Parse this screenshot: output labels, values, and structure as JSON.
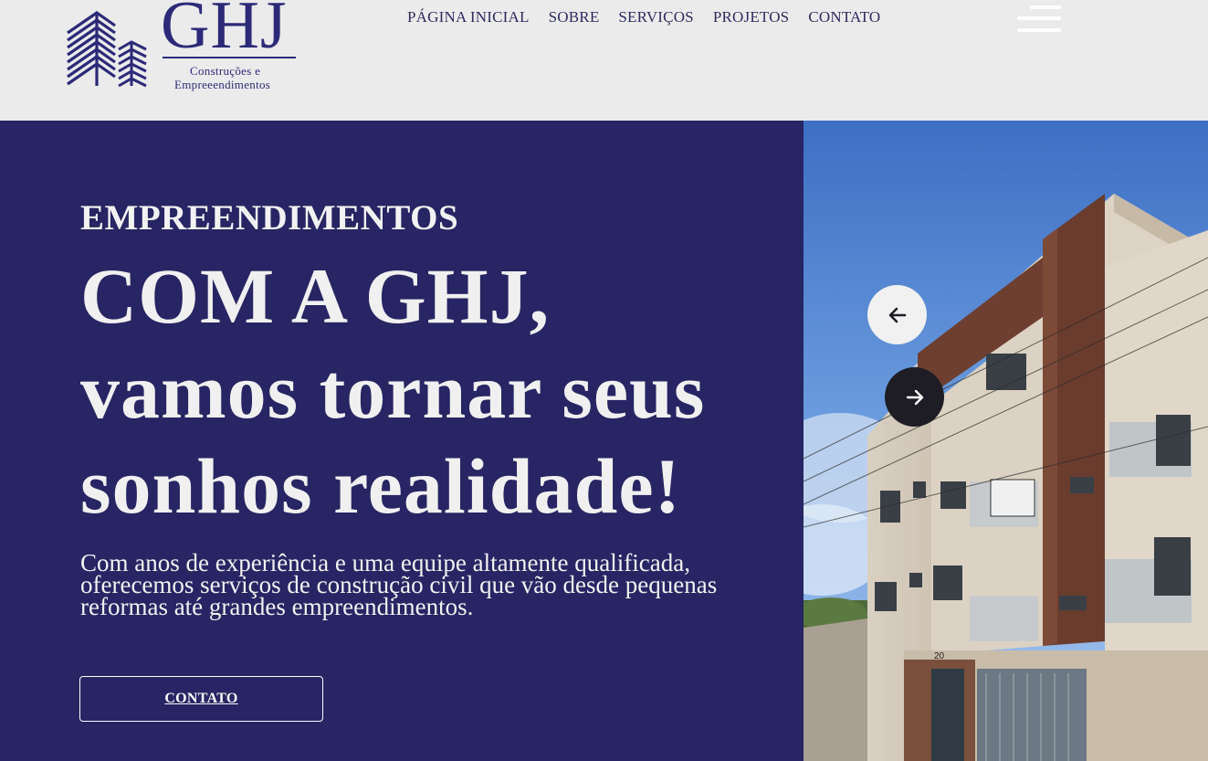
{
  "brand": {
    "name": "GHJ",
    "tagline_line1": "Construções e",
    "tagline_line2": "Empreeendimentos"
  },
  "nav": {
    "items": [
      {
        "label": "PÁGINA INICIAL"
      },
      {
        "label": "SOBRE"
      },
      {
        "label": "SERVIÇOS"
      },
      {
        "label": "PROJETOS"
      },
      {
        "label": "CONTATO"
      }
    ]
  },
  "hero": {
    "eyebrow": "EMPREENDIMENTOS",
    "headline_line1": "COM A GHJ,",
    "headline_line2": "vamos tornar seus",
    "headline_line3": "sonhos realidade!",
    "description": "Com anos de experiência e uma equipe altamente qualificada, oferecemos serviços de construção civil que vão desde pequenas reformas até grandes empreendimentos.",
    "cta_label": "CONTATO"
  },
  "carousel": {
    "prev_icon": "arrow-left-icon",
    "next_icon": "arrow-right-icon",
    "building_number": "20"
  },
  "colors": {
    "header_bg": "#ebebeb",
    "hero_bg": "#272563",
    "brand": "#2c2a78",
    "nav_text": "#2e2c5e"
  }
}
